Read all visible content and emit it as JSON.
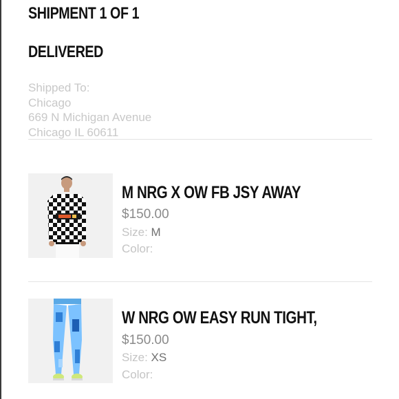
{
  "shipment": {
    "title": "SHIPMENT 1 OF 1",
    "status": "DELIVERED"
  },
  "address": {
    "label": "Shipped To:",
    "name": "Chicago",
    "street": "669 N Michigan Avenue",
    "city_line": "Chicago IL 60611"
  },
  "items": [
    {
      "name": "M NRG X OW FB JSY AWAY",
      "price": "$150.00",
      "size_label": "Size:",
      "size_value": "M",
      "color_label": "Color:",
      "color_value": ""
    },
    {
      "name": "W NRG OW EASY RUN TIGHT,",
      "price": "$150.00",
      "size_label": "Size:",
      "size_value": "XS",
      "color_label": "Color:",
      "color_value": ""
    }
  ],
  "colors": {
    "heading": "#111111",
    "muted_text": "#c8c8c8",
    "price_text": "#8a8a8a",
    "divider": "#e3e3e3"
  }
}
